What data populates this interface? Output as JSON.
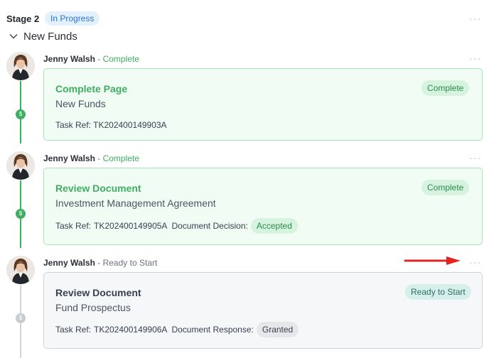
{
  "stage": {
    "title": "Stage 2",
    "badge": "In Progress",
    "more_label": "···"
  },
  "section": {
    "title": "New Funds",
    "chevron_icon": "chevron-down-icon"
  },
  "entries": [
    {
      "author": "Jenny Walsh",
      "separator": " - ",
      "status": "Complete",
      "more_label": "···",
      "node_icon": "dollar-icon",
      "card": {
        "title": "Complete Page",
        "subtitle": "New Funds",
        "badge": "Complete",
        "ref_label": "Task Ref:",
        "ref_value": "TK202400149903A"
      }
    },
    {
      "author": "Jenny Walsh",
      "separator": " - ",
      "status": "Complete",
      "more_label": "···",
      "node_icon": "dollar-icon",
      "card": {
        "title": "Review Document",
        "subtitle": "Investment Management Agreement",
        "badge": "Complete",
        "ref_label": "Task Ref:",
        "ref_value": "TK202400149905A",
        "extra_label": "Document Decision:",
        "extra_value": "Accepted"
      }
    },
    {
      "author": "Jenny Walsh",
      "separator": " - ",
      "status": "Ready to Start",
      "more_label": "···",
      "node_icon": "dollar-icon",
      "card": {
        "title": "Review Document",
        "subtitle": "Fund Prospectus",
        "badge": "Ready to Start",
        "ref_label": "Task Ref:",
        "ref_value": "TK202400149906A",
        "extra_label": "Document Response:",
        "extra_value": "Granted"
      }
    }
  ],
  "annotation": {
    "arrow_icon": "red-arrow-icon",
    "color": "#e02424"
  },
  "colors": {
    "complete": "#3fae63",
    "pending": "#c7ccd3",
    "badge_blue": "#2a72c8"
  }
}
